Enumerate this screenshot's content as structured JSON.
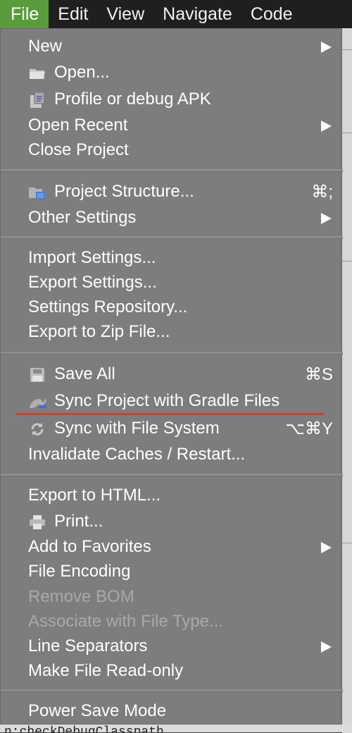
{
  "menubar": {
    "items": [
      "File",
      "Edit",
      "View",
      "Navigate",
      "Code"
    ]
  },
  "menu": {
    "items": [
      {
        "label": "New",
        "icon": null,
        "submenu": true
      },
      {
        "label": "Open...",
        "icon": "folder-icon"
      },
      {
        "label": "Profile or debug APK",
        "icon": "apk-icon"
      },
      {
        "label": "Open Recent",
        "submenu": true
      },
      {
        "label": "Close Project"
      },
      {
        "label": "Project Structure...",
        "icon": "project-structure-icon",
        "shortcut": "⌘;"
      },
      {
        "label": "Other Settings",
        "submenu": true
      },
      {
        "label": "Import Settings..."
      },
      {
        "label": "Export Settings..."
      },
      {
        "label": "Settings Repository..."
      },
      {
        "label": "Export to Zip File..."
      },
      {
        "label": "Save All",
        "icon": "save-icon",
        "shortcut": "⌘S"
      },
      {
        "label": "Sync Project with Gradle Files",
        "icon": "gradle-sync-icon",
        "highlighted": true
      },
      {
        "label": "Sync with File System",
        "icon": "refresh-icon",
        "shortcut": "⌥⌘Y"
      },
      {
        "label": "Invalidate Caches / Restart..."
      },
      {
        "label": "Export to HTML..."
      },
      {
        "label": "Print...",
        "icon": "printer-icon"
      },
      {
        "label": "Add to Favorites",
        "submenu": true
      },
      {
        "label": "File Encoding"
      },
      {
        "label": "Remove BOM",
        "disabled": true
      },
      {
        "label": "Associate with File Type...",
        "disabled": true
      },
      {
        "label": "Line Separators",
        "submenu": true
      },
      {
        "label": "Make File Read-only"
      },
      {
        "label": "Power Save Mode"
      }
    ]
  },
  "background": {
    "bottom_text": "n:checkDebugClasspath"
  },
  "colors": {
    "menubar_bg": "#1f1f1f",
    "active_menu": "#5a9c3c",
    "menu_bg": "#7d7d7f",
    "highlight_underline": "#c9442a"
  }
}
